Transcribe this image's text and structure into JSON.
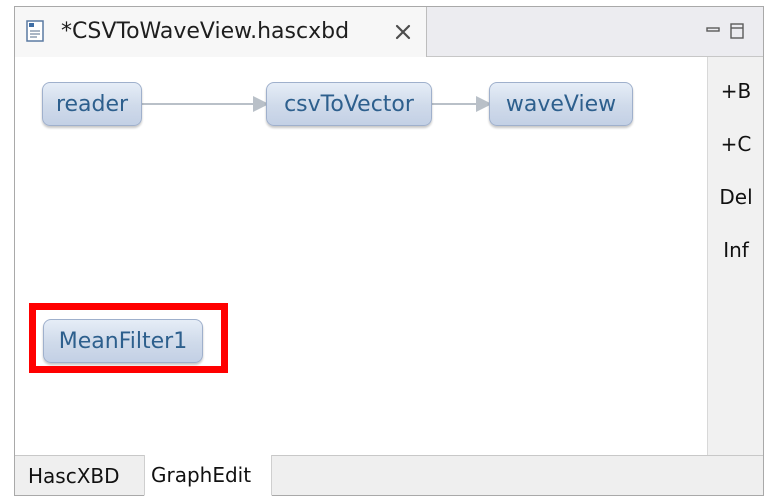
{
  "editor": {
    "tab_title": "*CSVToWaveView.hascxbd"
  },
  "graph": {
    "nodes": {
      "reader": "reader",
      "csv_to_vector": "csvToVector",
      "wave_view": "waveView",
      "mean_filter": "MeanFilter1"
    }
  },
  "palette": {
    "items": [
      "+B",
      "+C",
      "Del",
      "Inf"
    ]
  },
  "bottom_tabs": {
    "tab1": "HascXBD",
    "tab2": "GraphEdit"
  },
  "colors": {
    "selection": "#ff0000",
    "node_text": "#2d5f8d"
  }
}
